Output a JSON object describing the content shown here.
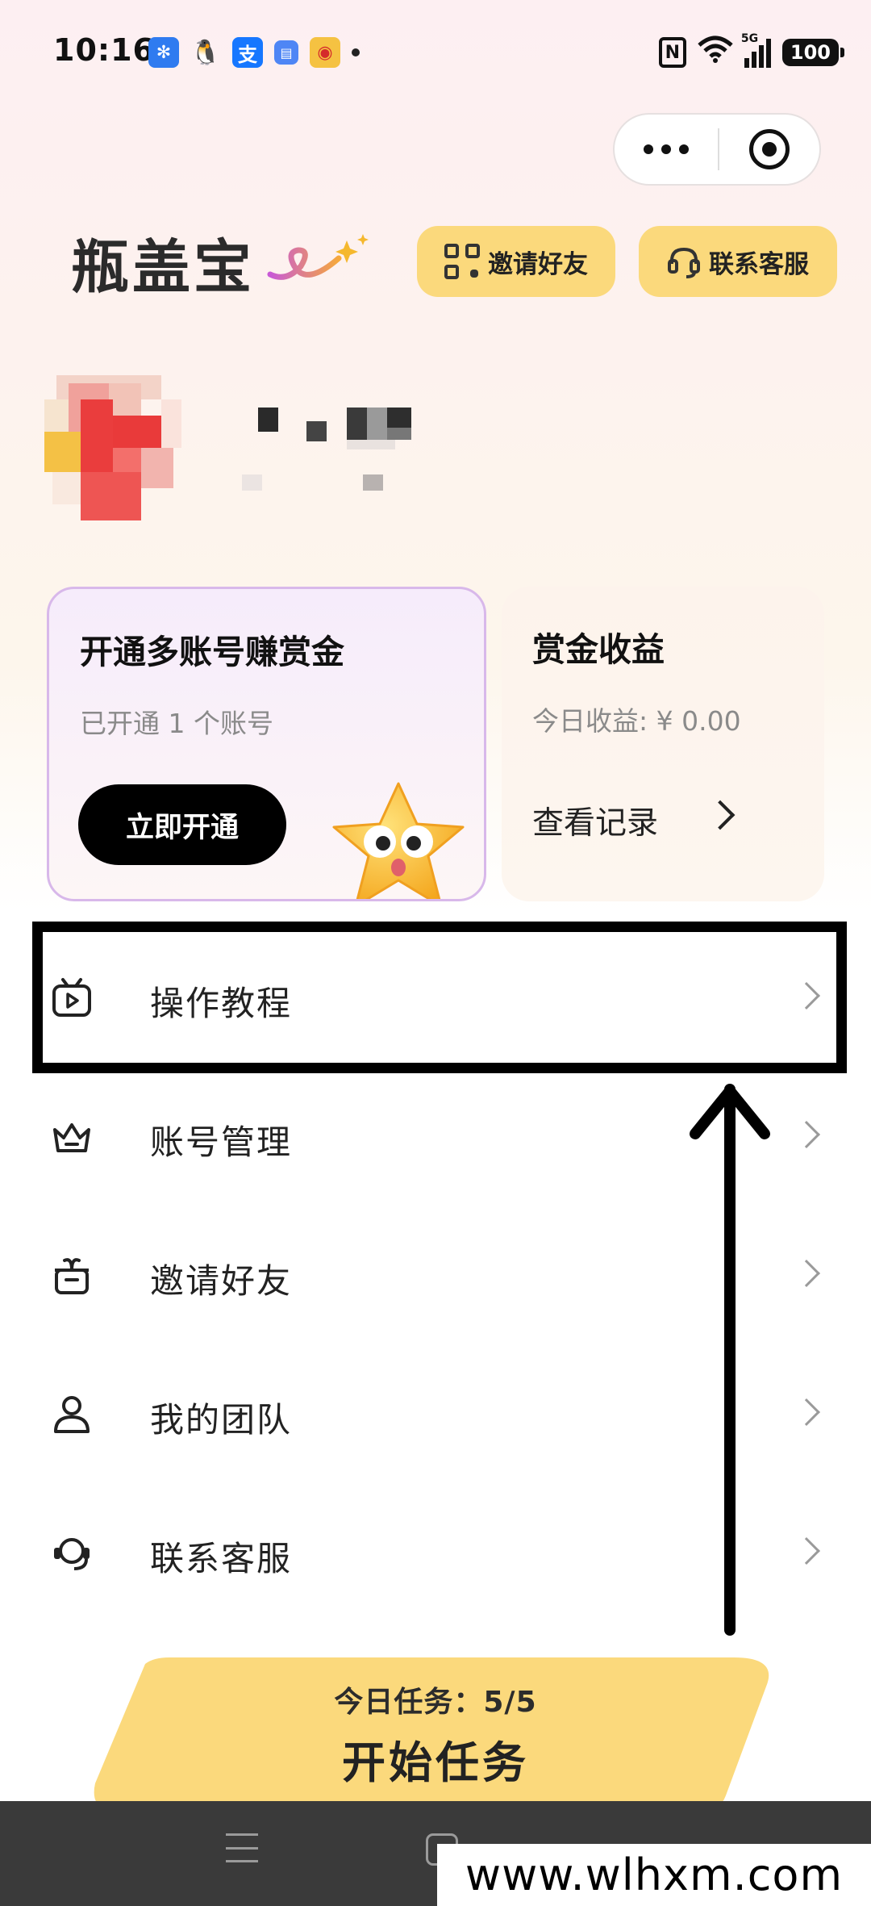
{
  "status_bar": {
    "time": "10:16",
    "battery": "100",
    "network": "5G",
    "notification_icons": [
      "pinwheel-app-icon",
      "qq-icon",
      "alipay-icon",
      "message-icon",
      "weibo-icon"
    ]
  },
  "capsule": {
    "more": "more-icon",
    "close": "close-miniprogram-icon"
  },
  "header": {
    "logo": "瓶盖宝",
    "invite_button": "邀请好友",
    "service_button": "联系客服"
  },
  "cards": {
    "multi_account": {
      "title": "开通多账号赚赏金",
      "subtitle": "已开通 1 个账号",
      "button": "立即开通"
    },
    "bounty": {
      "title": "赏金收益",
      "today": "今日收益: ¥ 0.00",
      "link": "查看记录"
    }
  },
  "menu": [
    {
      "label": "操作教程",
      "icon": "video-tutorial-icon"
    },
    {
      "label": "账号管理",
      "icon": "crown-icon"
    },
    {
      "label": "邀请好友",
      "icon": "gift-icon"
    },
    {
      "label": "我的团队",
      "icon": "user-icon"
    },
    {
      "label": "联系客服",
      "icon": "headset-icon"
    }
  ],
  "task": {
    "today": "今日任务：5/5",
    "start": "开始任务"
  },
  "watermark": "www.wlhxm.com",
  "colors": {
    "accent_yellow": "#fbd97c",
    "card_border_purple": "#d8b8ea",
    "button_black": "#000000"
  }
}
